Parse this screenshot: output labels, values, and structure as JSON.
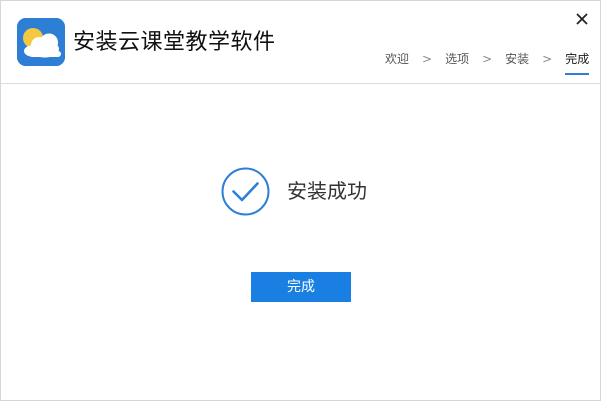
{
  "window": {
    "title": "安装云课堂教学软件",
    "close_icon": "close-icon",
    "app_icon": "cloud-sun-icon"
  },
  "steps": [
    {
      "label": "欢迎",
      "active": false
    },
    {
      "label": "选项",
      "active": false
    },
    {
      "label": "安装",
      "active": false
    },
    {
      "label": "完成",
      "active": true
    }
  ],
  "step_separator": ">",
  "status": {
    "icon": "checkmark-circle-icon",
    "text": "安装成功"
  },
  "finish_button": {
    "label": "完成"
  },
  "colors": {
    "accent": "#1a7fe3",
    "icon_bg": "#2d7fd6",
    "sun": "#f5c842"
  }
}
